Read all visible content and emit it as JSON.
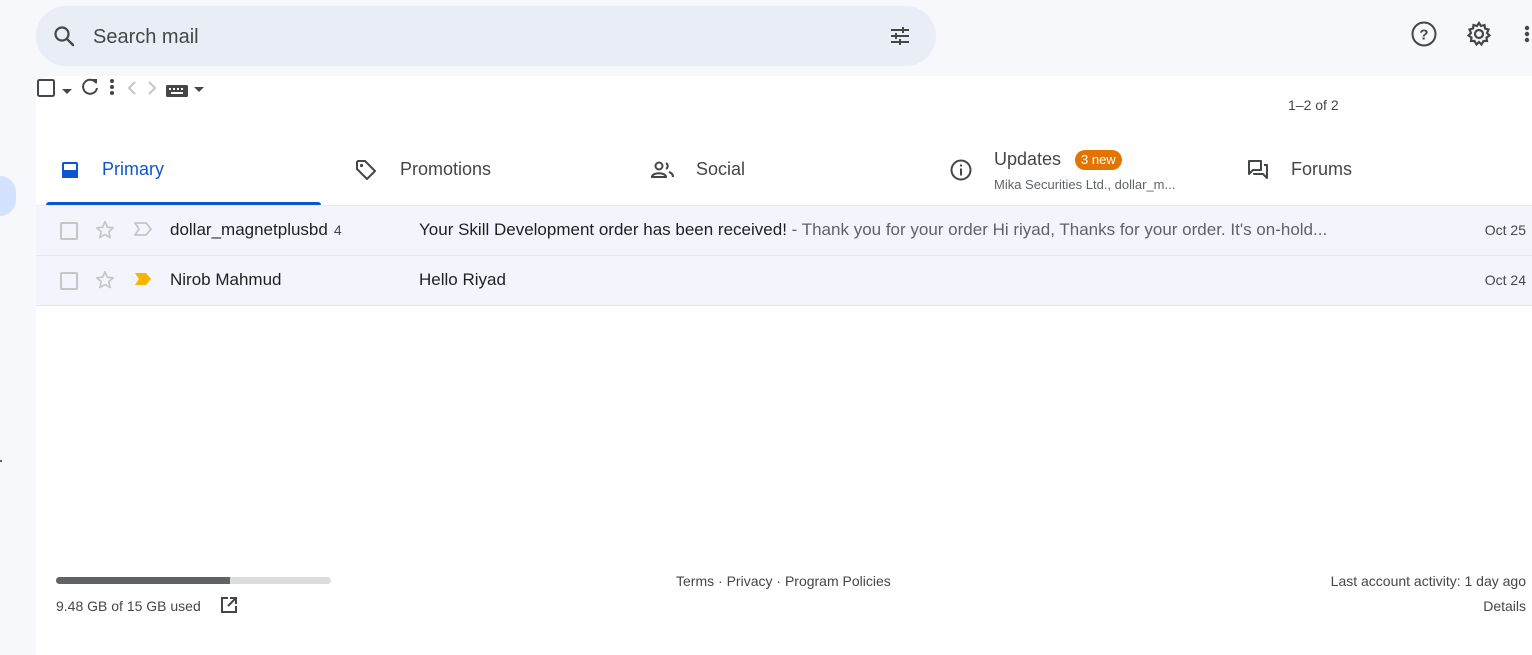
{
  "search": {
    "placeholder": "Search mail",
    "icon": "search-icon",
    "options_icon": "tune-icon"
  },
  "top_icons": [
    "help-icon",
    "settings-gear-icon",
    "apps-icon"
  ],
  "toolbar": {
    "page_count": "1–2 of 2"
  },
  "tabs": [
    {
      "label": "Primary",
      "icon": "inbox-icon",
      "active": true
    },
    {
      "label": "Promotions",
      "icon": "tag-icon",
      "active": false
    },
    {
      "label": "Social",
      "icon": "people-icon",
      "active": false
    },
    {
      "label": "Updates",
      "icon": "info-icon",
      "badge": "3 new",
      "subtitle": "Mika Securities Ltd., dollar_m...",
      "active": false
    },
    {
      "label": "Forums",
      "icon": "forum-icon",
      "active": false
    }
  ],
  "emails": [
    {
      "sender": "dollar_magnetplusbd",
      "count": "4",
      "subject": "Your Skill Development order has been received!",
      "snippet": " - Thank you for your order Hi riyad, Thanks for your order. It's on-hold...",
      "date": "Oct 25",
      "important": false
    },
    {
      "sender": "Nirob Mahmud",
      "count": "",
      "subject": "Hello Riyad",
      "snippet": "",
      "date": "Oct 24",
      "important": true
    }
  ],
  "footer": {
    "storage_text": "9.48 GB of 15 GB used",
    "storage_fraction": 0.632,
    "links": [
      "Terms",
      "Privacy",
      "Program Policies"
    ],
    "separator": " · ",
    "activity": "Last account activity: 1 day ago",
    "details": "Details"
  },
  "colors": {
    "accent": "#0b57d0",
    "badge": "#e37400",
    "important": "#f4b400"
  }
}
